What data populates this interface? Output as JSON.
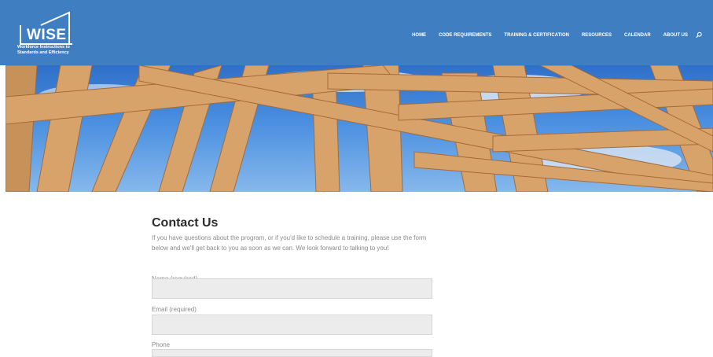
{
  "header": {
    "logo_text": "WISE",
    "logo_tagline": [
      "Workforce Instructions to",
      "Standards and Efficiency"
    ],
    "nav": [
      "HOME",
      "CODE REQUIREMENTS",
      "TRAINING & CERTIFICATION",
      "RESOURCES",
      "CALENDAR",
      "ABOUT US"
    ],
    "search_icon": "search-icon",
    "background": "#3f7fc1"
  },
  "main": {
    "title": "Contact Us",
    "intro": "If you have questions about the program, or if you'd like to schedule a training, please use the form below and we'll get back to you as soon as we can. We look forward to talking to you!",
    "form": {
      "name_label": "Name (required)",
      "name_value": "",
      "email_label": "Email (required)",
      "email_value": "",
      "phone_label": "Phone",
      "phone_value": ""
    }
  }
}
